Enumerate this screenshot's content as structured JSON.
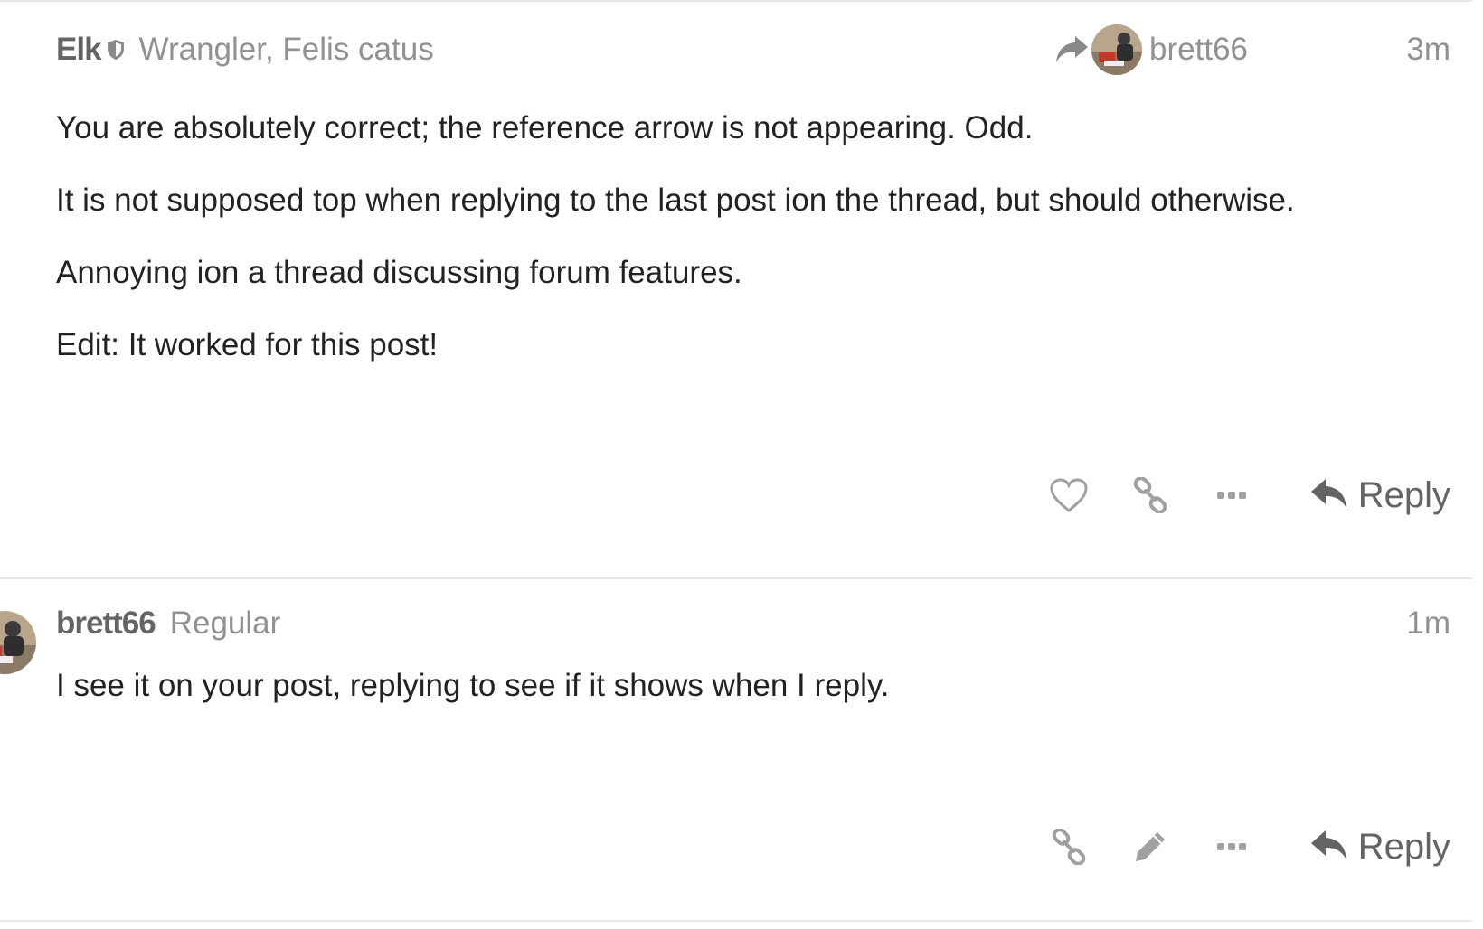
{
  "posts": [
    {
      "username": "Elk",
      "user_title": "Wrangler, Felis catus",
      "reply_to_username": "brett66",
      "time": "3m",
      "paragraphs": [
        "You are absolutely correct; the reference arrow is not appearing. Odd.",
        "It is not supposed top when replying to the last post ion the thread, but should otherwise.",
        "Annoying ion a thread discussing forum features.",
        "Edit: It worked for this post!"
      ],
      "reply_label": "Reply",
      "actions": [
        "heart-icon",
        "link-icon",
        "more-icon"
      ]
    },
    {
      "username": "brett66",
      "user_title": "Regular",
      "time": "1m",
      "paragraphs": [
        "I see it on your post, replying to see if it shows when I reply."
      ],
      "reply_label": "Reply",
      "actions": [
        "link-icon",
        "pencil-icon",
        "more-icon"
      ]
    }
  ],
  "colors": {
    "username": "#646464",
    "muted": "#919191",
    "body_text": "#222222",
    "divider": "#e6e6e6",
    "icon": "#a0a0a0"
  }
}
